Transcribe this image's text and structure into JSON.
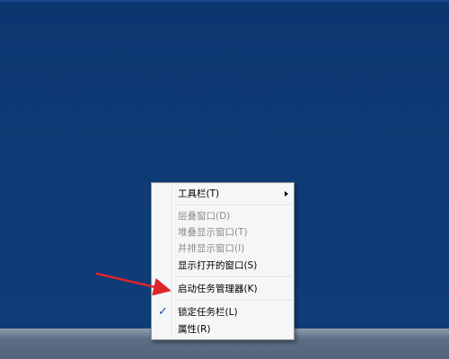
{
  "context_menu": {
    "items": [
      {
        "label": "工具栏(T)",
        "enabled": true,
        "has_submenu": true
      },
      {
        "label": "层叠窗口(D)",
        "enabled": false
      },
      {
        "label": "堆叠显示窗口(T)",
        "enabled": false
      },
      {
        "label": "并排显示窗口(I)",
        "enabled": false
      },
      {
        "label": "显示打开的窗口(S)",
        "enabled": true
      },
      {
        "label": "启动任务管理器(K)",
        "enabled": true
      },
      {
        "label": "锁定任务栏(L)",
        "enabled": true,
        "checked": true
      },
      {
        "label": "属性(R)",
        "enabled": true
      }
    ],
    "check_glyph": "✓"
  },
  "colors": {
    "desktop": "#0e3a74",
    "annotation_arrow": "#e0242b"
  }
}
